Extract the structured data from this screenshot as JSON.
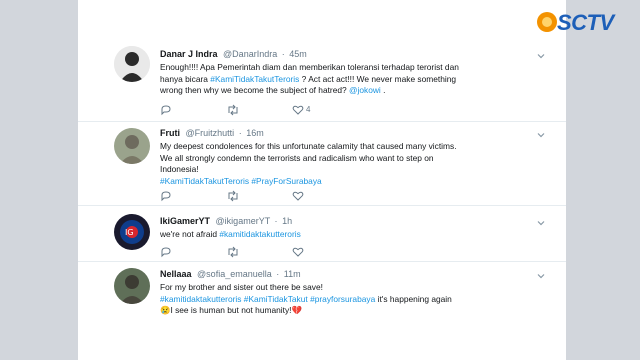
{
  "channel_logo": {
    "text": "SCTV"
  },
  "tweets": [
    {
      "name": "Danar J Indra",
      "handle": "@DanarIndra",
      "time": "45m",
      "lines": [
        [
          {
            "t": "Enough!!!! Apa Pemerintah diam dan memberikan toleransi terhadap terorist dan",
            "h": false
          }
        ],
        [
          {
            "t": "hanya bicara ",
            "h": false
          },
          {
            "t": "#KamiTidakTakutTeroris",
            "h": true
          },
          {
            "t": " ? Act act act!!! We never make something",
            "h": false
          }
        ],
        [
          {
            "t": "wrong then why we become the subject of hatred? ",
            "h": false
          },
          {
            "t": "@jokowi",
            "h": true
          },
          {
            "t": " .",
            "h": false
          }
        ]
      ],
      "like_count": "4"
    },
    {
      "name": "Fruti",
      "handle": "@Fruitzhutti",
      "time": "16m",
      "lines": [
        [
          {
            "t": "My deepest condolences for this unfortunate calamity that caused many victims.",
            "h": false
          }
        ],
        [
          {
            "t": "We all strongly condemn the terrorists and radicalism who want to step on",
            "h": false
          }
        ],
        [
          {
            "t": "Indonesia!",
            "h": false
          }
        ],
        [
          {
            "t": "#KamiTidakTakutTeroris",
            "h": true
          },
          {
            "t": " ",
            "h": false
          },
          {
            "t": "#PrayForSurabaya",
            "h": true
          }
        ]
      ],
      "like_count": ""
    },
    {
      "name": "IkiGamerYT",
      "handle": "@ikigamerYT",
      "time": "1h",
      "lines": [
        [
          {
            "t": "we're not afraid ",
            "h": false
          },
          {
            "t": "#kamitidaktakutteroris",
            "h": true
          }
        ]
      ],
      "like_count": ""
    },
    {
      "name": "Nellaaa",
      "handle": "@sofia_emanuella",
      "time": "11m",
      "lines": [
        [
          {
            "t": "For my brother and sister out there be save!",
            "h": false
          }
        ],
        [
          {
            "t": "#kamitidaktakutteroris",
            "h": true
          },
          {
            "t": " ",
            "h": false
          },
          {
            "t": "#KamiTidakTakut",
            "h": true
          },
          {
            "t": " ",
            "h": false
          },
          {
            "t": "#prayforsurabaya",
            "h": true
          },
          {
            "t": " it's happening again",
            "h": false
          }
        ],
        [
          {
            "t": "😢",
            "h": false
          },
          {
            "t": "I see is human but not humanity!",
            "h": false
          },
          {
            "t": "💔",
            "h": false
          }
        ]
      ],
      "like_count": ""
    }
  ],
  "icons": {
    "reply": "reply-icon",
    "retweet": "retweet-icon",
    "like": "heart-icon",
    "more": "chevron-down-icon"
  }
}
